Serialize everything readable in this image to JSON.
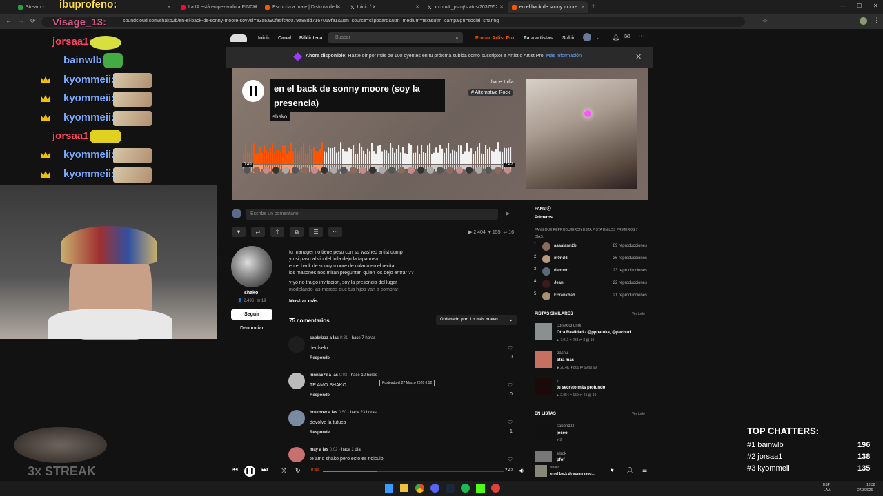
{
  "tabs": [
    {
      "title": "Stream -",
      "color": "#2ea043"
    },
    {
      "title": "La IA está empezando a PINCH",
      "color": "#ff0033"
    },
    {
      "title": "Escucha a mate | Disfruta de la",
      "color": "#ff5500"
    },
    {
      "title": "Inicio / X",
      "color": "#ffffff"
    },
    {
      "title": "x.com/k_psmj/status/2037552",
      "color": "#ffffff"
    },
    {
      "title": "en el back de sonny moore",
      "color": "#ff5500"
    }
  ],
  "url": "soundcloud.com/shako2b/en-el-back-de-sonny-moore-soy?si=a3a6a90fa5fc4c079a88dd7167019fa1&utm_source=clipboard&utm_medium=text&utm_campaign=social_sharing",
  "nav": {
    "home": "Inicio",
    "feed": "Canal",
    "library": "Biblioteca",
    "search_placeholder": "Buscar",
    "pro": "Probar Artist Pro",
    "artists": "Para artistas",
    "upload": "Subir"
  },
  "banner": {
    "bold": "Ahora disponible:",
    "text": "Hazte oír por más de 100 oyentes en tu próxima subida como suscriptor a Artist o Artist Pro.",
    "link": "Más información"
  },
  "track": {
    "title": "en el back de sonny moore (soy la presencia)",
    "artist": "shako",
    "time_ago": "hace 1 día",
    "tag": "# Alternative Rock",
    "start": "0:49",
    "end": "2:42",
    "progress": 0.3
  },
  "comment_placeholder": "Escribe un comentario",
  "stats": {
    "plays": "2.404",
    "likes": "155",
    "reposts": "16"
  },
  "artist": {
    "name": "shako",
    "followers": "2.496",
    "tracks": "19",
    "follow": "Seguir",
    "report": "Denunciar"
  },
  "lyrics": [
    "tu manager no tiene peso con su washed artist dump",
    "yo si paso al vip del lolla dejo la tapa mea",
    "en el back de sonny moore de colado en el recital",
    "los masones nos miran preguntan quien los dejo entrar ??",
    "y yo no traigo invitacion, soy la presencia del lugar",
    "modelando las marcas que tus hijos van a comprar"
  ],
  "show_more": "Mostrar más",
  "comments_count": "75 comentarios",
  "sort": "Ordenado por: Lo más nuevo",
  "comments": [
    {
      "user": "sabbrizzz a las",
      "time": "0:31",
      "ago": "· hace 7 horas",
      "text": "decíselo",
      "reply": "Responde",
      "likes": "0"
    },
    {
      "user": "lunna576 a las",
      "time": "0:03",
      "ago": "· hace 12 horas",
      "text": "TE AMO SHAKO",
      "reply": "Responde",
      "likes": "0"
    },
    {
      "user": "bruknow a las",
      "time": "0:50",
      "ago": "· hace 23 horas",
      "text": "devolve la tutuca",
      "reply": "Responde",
      "likes": "1"
    },
    {
      "user": "may a las",
      "time": "0:02",
      "ago": "· hace 1 día",
      "text": "te amo shako pero esto es ridiculo",
      "reply": "",
      "likes": ""
    }
  ],
  "tooltip": "Posteado el 27 Marzo 2026 0:52",
  "fans": {
    "title": "FANS",
    "tab": "Primeros",
    "desc": "FANS QUE REPRODUJERON ESTA PISTA EN LOS PRIMEROS 7 DÍAS:",
    "list": [
      {
        "rank": "1",
        "name": "aaaalann2b",
        "plays": "89 reproducciones"
      },
      {
        "rank": "2",
        "name": "m0nd4i",
        "plays": "36 reproducciones"
      },
      {
        "rank": "3",
        "name": "dammtt",
        "plays": "23 reproducciones"
      },
      {
        "rank": "4",
        "name": "Jean",
        "plays": "22 reproducciones"
      },
      {
        "rank": "5",
        "name": "FFrankheh",
        "plays": "21 reproducciones"
      }
    ]
  },
  "similar": {
    "title": "PISTAS SIMILARES",
    "see_all": "Ver todo",
    "list": [
      {
        "user": "conexiondmk",
        "title": "Otra Realidad - @pppatuka, @pachud...",
        "stats": "▶ 7.911  ♥ 233  ⇄ 8  ▤ 10"
      },
      {
        "user": "pachu",
        "title": "otra mas",
        "stats": "▶ 20,4K  ♥ 860  ⇄ 69  ▤ 69"
      },
      {
        "user": "♪",
        "title": "tu secreto más profundo",
        "stats": "▶ 2.954  ♥ 159  ⇄ 21  ▤ 19"
      }
    ]
  },
  "lists": {
    "title": "EN LISTAS",
    "see_all": "Ver todo",
    "list": [
      {
        "user": "sabbrizzz",
        "title": "joseo",
        "stats": "♥ 3"
      },
      {
        "user": "elsok",
        "title": "pfof",
        "stats": ""
      }
    ]
  },
  "player": {
    "current": "0:49",
    "total": "2:42",
    "artist": "shako",
    "title": "en el back de sonny moo..."
  },
  "chat": [
    {
      "name": "ibuprofeno:",
      "color": "#ffdd44"
    },
    {
      "name": "Visage_13:",
      "color": "#ff66aa"
    },
    {
      "name": "jorsaa1:",
      "color": "#ff4466"
    },
    {
      "name": "bainwlb:",
      "color": "#77aaff"
    },
    {
      "name": "kyommeii:",
      "color": "#77aaff"
    },
    {
      "name": "kyommeii:",
      "color": "#77aaff"
    },
    {
      "name": "kyommeii:",
      "color": "#77aaff"
    },
    {
      "name": "jorsaa1:",
      "color": "#ff4466"
    },
    {
      "name": "kyommeii:",
      "color": "#77aaff"
    },
    {
      "name": "kyommeii:",
      "color": "#77aaff"
    }
  ],
  "streak": "3x STREAK",
  "top_chatters": {
    "title": "TOP CHATTERS:",
    "list": [
      {
        "name": "#1 bainwlb",
        "count": "196"
      },
      {
        "name": "#2 jorsaa1",
        "count": "138"
      },
      {
        "name": "#3 kyommeii",
        "count": "135"
      }
    ]
  },
  "clock": {
    "lang": "ESP",
    "layout": "LAA",
    "time": "13:38",
    "date": "27/3/2026"
  }
}
